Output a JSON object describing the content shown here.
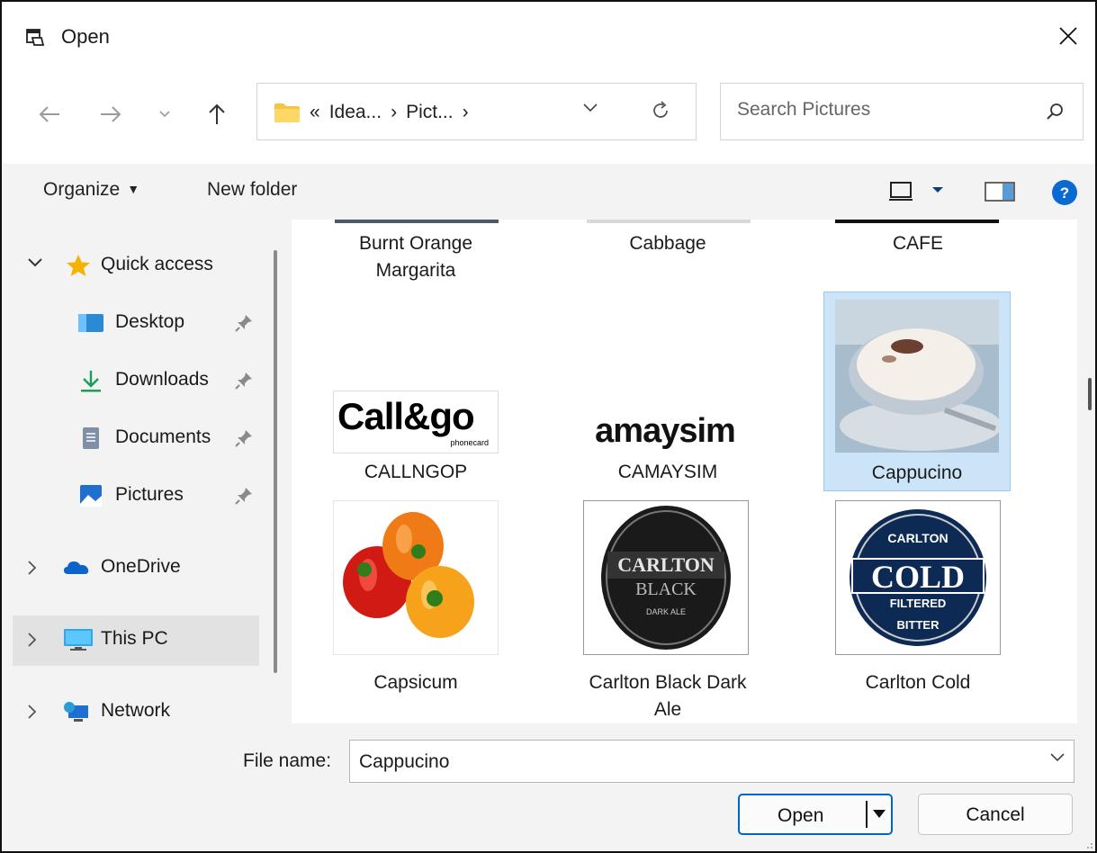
{
  "window": {
    "title": "Open",
    "close_icon": "close-icon"
  },
  "nav": {
    "breadcrumb": [
      "«",
      "Idea...",
      "›",
      "Pict...",
      "›"
    ],
    "search_placeholder": "Search Pictures"
  },
  "commandbar": {
    "organize": "Organize",
    "new_folder": "New folder"
  },
  "navpane": {
    "quick_access": "Quick access",
    "items": [
      {
        "label": "Desktop",
        "icon": "desktop-icon",
        "pinned": true
      },
      {
        "label": "Downloads",
        "icon": "downloads-icon",
        "pinned": true
      },
      {
        "label": "Documents",
        "icon": "documents-icon",
        "pinned": true
      },
      {
        "label": "Pictures",
        "icon": "pictures-icon",
        "pinned": true
      }
    ],
    "onedrive": "OneDrive",
    "this_pc": "This PC",
    "network": "Network"
  },
  "files": [
    {
      "name": "Burnt Orange Margarita"
    },
    {
      "name": "Cabbage"
    },
    {
      "name": "CAFE"
    },
    {
      "name": "CALLNGOP",
      "thumb_text": "Call&go",
      "thumb_sub": "phonecard"
    },
    {
      "name": "CAMAYSIM",
      "thumb_text": "amaysim"
    },
    {
      "name": "Cappucino",
      "selected": true
    },
    {
      "name": "Capsicum"
    },
    {
      "name": "Carlton Black Dark Ale",
      "thumb_lines": [
        "CARLTON",
        "BLACK",
        "DARK ALE"
      ]
    },
    {
      "name": "Carlton Cold",
      "thumb_lines": [
        "CARLTON",
        "COLD",
        "FILTERED",
        "BITTER"
      ]
    }
  ],
  "footer": {
    "file_name_label": "File name:",
    "file_name_value": "Cappucino",
    "open_label": "Open",
    "cancel_label": "Cancel"
  },
  "colors": {
    "accent": "#0067c0",
    "selection": "#cce4f7",
    "help": "#0a6ad1"
  }
}
